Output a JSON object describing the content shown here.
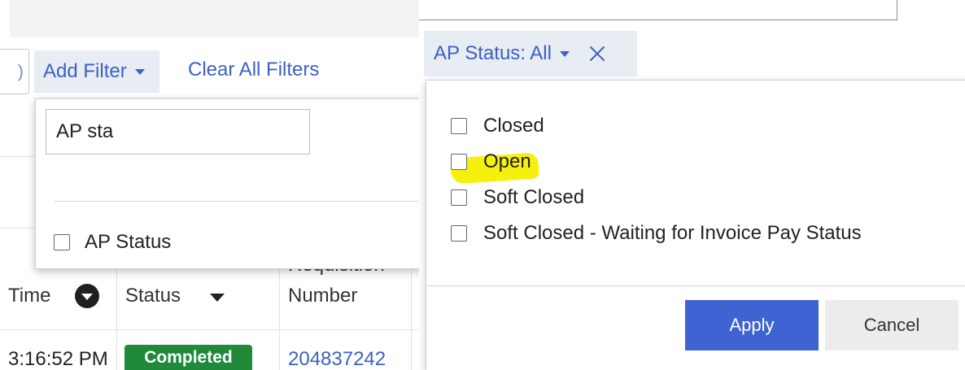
{
  "left": {
    "add_filter_label": "Add Filter",
    "clear_all_label": "Clear All Filters",
    "prev_input_fragment": ")",
    "filter_search_value": "AP sta",
    "filter_options": [
      {
        "label": "AP Status",
        "checked": false
      }
    ],
    "table": {
      "columns": [
        "Time",
        "Status",
        "Requisition",
        "Number"
      ],
      "row": {
        "time": "3:16:52 PM",
        "status": "Completed",
        "requisition_number": "204837242"
      }
    }
  },
  "right": {
    "chip_label": "AP Status: All",
    "options": [
      {
        "label": "Closed",
        "checked": false
      },
      {
        "label": "Open",
        "checked": false
      },
      {
        "label": "Soft Closed",
        "checked": false
      },
      {
        "label": "Soft Closed - Waiting for Invoice Pay Status",
        "checked": false
      }
    ],
    "apply_label": "Apply",
    "cancel_label": "Cancel"
  },
  "colors": {
    "link_blue": "#3d61c4",
    "chip_bg": "#e8ecf3",
    "apply_bg": "#3f63d2",
    "badge_green": "#1e8a3a",
    "highlight_yellow": "#f5ef00"
  }
}
